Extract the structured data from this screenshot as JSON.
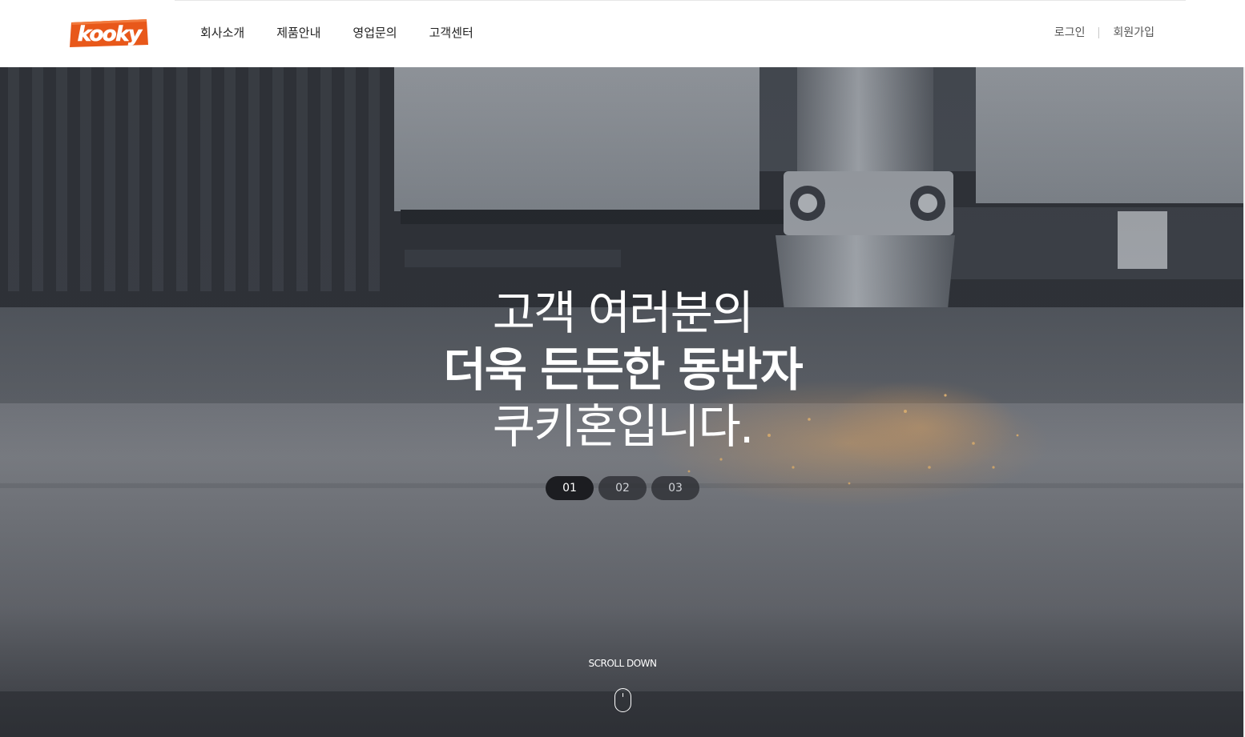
{
  "brand": {
    "logo_text": "kooky",
    "logo_color": "#ea5a1c"
  },
  "nav": {
    "items": [
      {
        "label": "회사소개"
      },
      {
        "label": "제품안내"
      },
      {
        "label": "영업문의"
      },
      {
        "label": "고객센터"
      }
    ]
  },
  "utility": {
    "login": "로그인",
    "signup": "회원가입"
  },
  "hero": {
    "headline_line1": "고객 여러분의",
    "headline_line2": "더욱 든든한 동반자",
    "headline_line3": "쿠키혼입니다.",
    "slides": [
      "01",
      "02",
      "03"
    ],
    "active_slide": "01",
    "scroll_label": "SCROLL DOWN",
    "icons": {
      "scroll": "mouse-icon"
    },
    "colors": {
      "overlay": "#3d424b",
      "sparks": "#e8a25a",
      "text": "#ffffff"
    }
  }
}
